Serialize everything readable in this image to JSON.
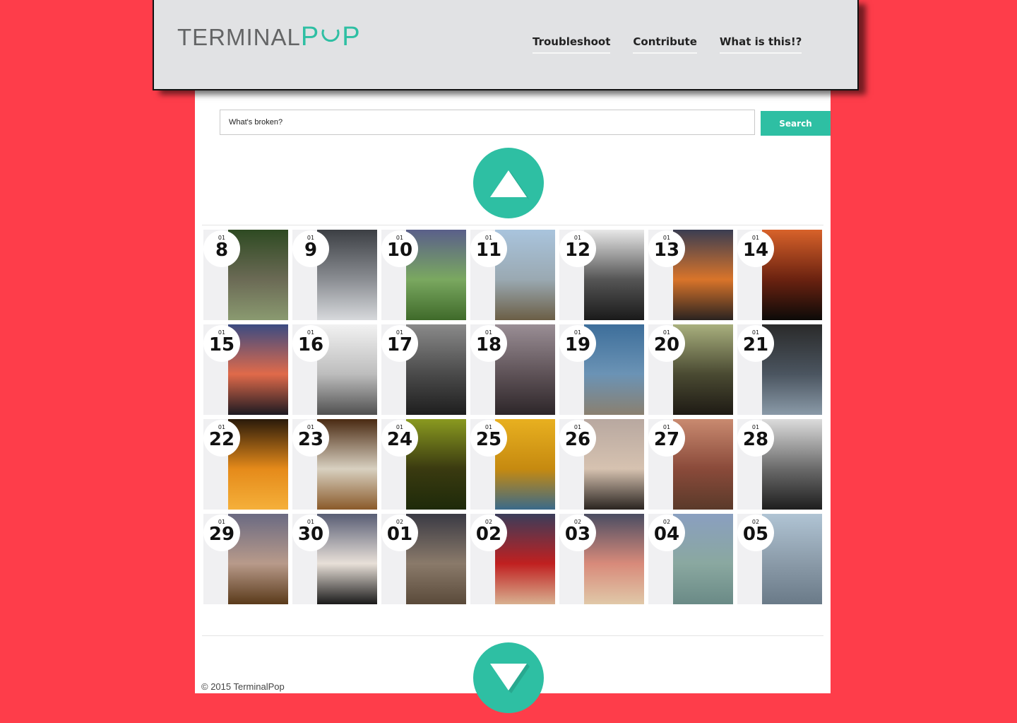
{
  "brand": {
    "part1": "TERMINAL",
    "part2": "P",
    "part3": "P"
  },
  "nav": [
    "Troubleshoot",
    "Contribute",
    "What is this!?"
  ],
  "search": {
    "placeholder": "What's broken?",
    "button": "Search"
  },
  "up_icon": "triangle-up-icon",
  "down_icon": "triangle-down-icon",
  "accent_color": "#2ebfa3",
  "background_color": "#fe3d4a",
  "tiles": [
    {
      "month": "01",
      "day": "8",
      "photo": "tree",
      "colors": [
        "#2e4a22",
        "#6b6a55",
        "#8a9a70"
      ]
    },
    {
      "month": "01",
      "day": "9",
      "photo": "clouds",
      "colors": [
        "#3c3f44",
        "#8a8d92",
        "#d7d9dc"
      ]
    },
    {
      "month": "01",
      "day": "10",
      "photo": "field",
      "colors": [
        "#5a5f8a",
        "#7aa860",
        "#3f6a2a"
      ]
    },
    {
      "month": "01",
      "day": "11",
      "photo": "beach",
      "colors": [
        "#a9c4dd",
        "#9aa9b2",
        "#6b5e45"
      ]
    },
    {
      "month": "01",
      "day": "12",
      "photo": "bw-tree",
      "colors": [
        "#e8e8e8",
        "#555555",
        "#1a1a1a"
      ]
    },
    {
      "month": "01",
      "day": "13",
      "photo": "sunset-water",
      "colors": [
        "#3a3d52",
        "#d9742a",
        "#2a2320"
      ]
    },
    {
      "month": "01",
      "day": "14",
      "photo": "silhouette-trees",
      "colors": [
        "#d8622a",
        "#6b2210",
        "#0c0a08"
      ]
    },
    {
      "month": "01",
      "day": "15",
      "photo": "dock-sunset",
      "colors": [
        "#3b4b82",
        "#e06a4a",
        "#1d1a22"
      ]
    },
    {
      "month": "01",
      "day": "16",
      "photo": "grass-fog",
      "colors": [
        "#f2f2f2",
        "#bdbdbd",
        "#505050"
      ]
    },
    {
      "month": "01",
      "day": "17",
      "photo": "shore-bw",
      "colors": [
        "#8a8a8a",
        "#4a4a4a",
        "#1e1e1e"
      ]
    },
    {
      "month": "01",
      "day": "18",
      "photo": "foggy-sun",
      "colors": [
        "#9a8e95",
        "#5e5257",
        "#2d2629"
      ]
    },
    {
      "month": "01",
      "day": "19",
      "photo": "person-rocks",
      "colors": [
        "#3d6e9a",
        "#6b93b5",
        "#8a8070"
      ]
    },
    {
      "month": "01",
      "day": "20",
      "photo": "couple-forest",
      "colors": [
        "#a9b07e",
        "#4a4a32",
        "#1e1a14"
      ]
    },
    {
      "month": "01",
      "day": "21",
      "photo": "jeans",
      "colors": [
        "#2a2a2a",
        "#4b5560",
        "#8a9aa8"
      ]
    },
    {
      "month": "01",
      "day": "22",
      "photo": "tictactoe",
      "colors": [
        "#2a1a0a",
        "#e58a1a",
        "#f5b03a"
      ]
    },
    {
      "month": "01",
      "day": "23",
      "photo": "coats",
      "colors": [
        "#4a2a12",
        "#d8d0c0",
        "#8a5a2a"
      ]
    },
    {
      "month": "01",
      "day": "24",
      "photo": "cat",
      "colors": [
        "#8a9a20",
        "#3a3a10",
        "#1e2a0a"
      ]
    },
    {
      "month": "01",
      "day": "25",
      "photo": "sunflower",
      "colors": [
        "#e8b020",
        "#c68a10",
        "#3a6a8a"
      ]
    },
    {
      "month": "01",
      "day": "26",
      "photo": "chair-beach",
      "colors": [
        "#b8a8a0",
        "#d6c2b0",
        "#2a2420"
      ]
    },
    {
      "month": "01",
      "day": "27",
      "photo": "rusty-truck",
      "colors": [
        "#c98a70",
        "#8a4a3a",
        "#5a3a2a"
      ]
    },
    {
      "month": "01",
      "day": "28",
      "photo": "boat-bw",
      "colors": [
        "#dcdcdc",
        "#6a6a6a",
        "#1e1e1e"
      ]
    },
    {
      "month": "01",
      "day": "29",
      "photo": "mask",
      "colors": [
        "#6a6a82",
        "#b89a8a",
        "#5a3a1a"
      ]
    },
    {
      "month": "01",
      "day": "30",
      "photo": "nun-dolls",
      "colors": [
        "#585d74",
        "#e8e0d8",
        "#1a1a1a"
      ]
    },
    {
      "month": "02",
      "day": "01",
      "photo": "skull",
      "colors": [
        "#3a3a44",
        "#8a7a6a",
        "#5a4a3a"
      ]
    },
    {
      "month": "02",
      "day": "02",
      "photo": "doll-red-cap",
      "colors": [
        "#3a3d5a",
        "#c02020",
        "#d8b090"
      ]
    },
    {
      "month": "02",
      "day": "03",
      "photo": "pinocchio",
      "colors": [
        "#4a4d62",
        "#d88a7a",
        "#e0c8a8"
      ]
    },
    {
      "month": "02",
      "day": "04",
      "photo": "egg",
      "colors": [
        "#8a9fc0",
        "#8aa8a0",
        "#6a8a86"
      ]
    },
    {
      "month": "02",
      "day": "05",
      "photo": "bottles",
      "colors": [
        "#b0c4d4",
        "#8a9aa8",
        "#6a7a88"
      ]
    }
  ],
  "footer": "© 2015 TerminalPop"
}
